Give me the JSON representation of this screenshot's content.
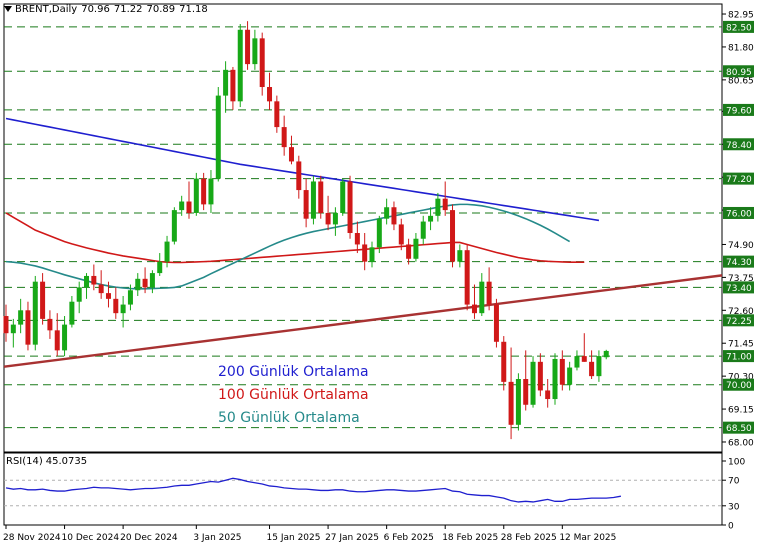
{
  "header": {
    "symbol": "BRENT,Daily",
    "open": "70.96",
    "high": "71.22",
    "low": "70.89",
    "close": "71.18"
  },
  "legend": [
    {
      "label": "200 Günlük Ortalama",
      "color": "#1f1fcf"
    },
    {
      "label": "100 Günlük Ortalama",
      "color": "#d01818"
    },
    {
      "label": "50 Günlük Ortalama",
      "color": "#258a8a"
    }
  ],
  "rsi": {
    "label": "RSI(14)",
    "value": "45.0735",
    "ticks": [
      "100",
      "70",
      "30",
      "0"
    ]
  },
  "chart_data": {
    "type": "candlestick",
    "colors": {
      "up": "#17a817",
      "down": "#d01818",
      "ma200": "#1f1fcf",
      "ma100": "#d01818",
      "ma50": "#258a8a",
      "trendline": "#a83232",
      "rsi": "#1f1fcf"
    },
    "price_axis": {
      "ylim": [
        67.65,
        83.3
      ],
      "ticks": [
        "82.95",
        "81.80",
        "80.65",
        "79.55",
        "78.40",
        "77.25",
        "76.10",
        "74.90",
        "73.75",
        "72.60",
        "71.45",
        "70.30",
        "69.15",
        "68.00"
      ]
    },
    "level_lines": [
      82.5,
      80.95,
      79.6,
      78.4,
      77.2,
      76.0,
      74.3,
      73.4,
      72.25,
      71.0,
      70.0,
      68.5
    ],
    "level_labels": [
      "82.50",
      "80.95",
      "79.60",
      "78.40",
      "77.20",
      "76.00",
      "74.30",
      "73.40",
      "72.25",
      "71.00",
      "70.00",
      "68.50"
    ],
    "x_labels": [
      "28 Nov 2024",
      "10 Dec 2024",
      "20 Dec 2024",
      "3 Jan 2025",
      "15 Jan 2025",
      "27 Jan 2025",
      "6 Feb 2025",
      "18 Feb 2025",
      "28 Feb 2025",
      "12 Mar 2025"
    ],
    "x_label_index": [
      0,
      8,
      16,
      26,
      36,
      44,
      52,
      60,
      68,
      76
    ],
    "candles": [
      [
        72.4,
        72.8,
        71.5,
        71.8
      ],
      [
        71.8,
        72.3,
        71.3,
        72.1
      ],
      [
        72.1,
        73.0,
        71.8,
        72.6
      ],
      [
        72.6,
        72.9,
        71.2,
        71.4
      ],
      [
        71.4,
        73.8,
        71.2,
        73.6
      ],
      [
        73.6,
        73.9,
        72.1,
        72.3
      ],
      [
        72.3,
        72.6,
        71.6,
        71.9
      ],
      [
        71.9,
        72.5,
        71.0,
        71.2
      ],
      [
        71.2,
        72.4,
        71.0,
        72.1
      ],
      [
        72.1,
        73.1,
        72.0,
        72.9
      ],
      [
        72.9,
        73.6,
        72.5,
        73.4
      ],
      [
        73.4,
        73.9,
        73.0,
        73.8
      ],
      [
        73.8,
        74.2,
        73.3,
        73.5
      ],
      [
        73.5,
        74.0,
        73.0,
        73.2
      ],
      [
        73.2,
        73.6,
        72.7,
        73.0
      ],
      [
        73.0,
        73.4,
        72.3,
        72.5
      ],
      [
        72.5,
        73.1,
        72.0,
        72.8
      ],
      [
        72.8,
        73.5,
        72.6,
        73.3
      ],
      [
        73.3,
        73.9,
        73.1,
        73.7
      ],
      [
        73.7,
        74.1,
        73.2,
        73.4
      ],
      [
        73.4,
        74.0,
        73.2,
        73.9
      ],
      [
        73.9,
        74.6,
        73.8,
        74.3
      ],
      [
        74.3,
        75.2,
        74.1,
        75.0
      ],
      [
        75.0,
        76.2,
        74.9,
        76.1
      ],
      [
        76.1,
        76.6,
        75.9,
        76.4
      ],
      [
        76.4,
        77.1,
        75.8,
        76.0
      ],
      [
        76.0,
        77.4,
        75.9,
        77.2
      ],
      [
        77.2,
        77.4,
        76.1,
        76.3
      ],
      [
        76.3,
        77.5,
        76.0,
        77.2
      ],
      [
        77.2,
        80.4,
        77.1,
        80.1
      ],
      [
        80.1,
        81.3,
        79.5,
        81.0
      ],
      [
        81.0,
        81.1,
        79.6,
        79.9
      ],
      [
        79.9,
        82.6,
        79.7,
        82.4
      ],
      [
        82.4,
        82.7,
        81.0,
        81.2
      ],
      [
        81.2,
        82.4,
        81.0,
        82.1
      ],
      [
        82.1,
        82.3,
        80.1,
        80.4
      ],
      [
        80.4,
        80.9,
        79.6,
        79.9
      ],
      [
        79.9,
        80.1,
        78.8,
        79.0
      ],
      [
        79.0,
        79.4,
        78.0,
        78.3
      ],
      [
        78.3,
        78.7,
        77.7,
        77.8
      ],
      [
        77.8,
        78.0,
        76.5,
        76.8
      ],
      [
        76.8,
        77.2,
        75.5,
        75.8
      ],
      [
        75.8,
        77.3,
        75.6,
        77.1
      ],
      [
        77.1,
        77.3,
        75.8,
        76.0
      ],
      [
        76.0,
        76.6,
        75.4,
        75.6
      ],
      [
        75.6,
        76.2,
        75.2,
        76.0
      ],
      [
        76.0,
        77.2,
        75.9,
        77.1
      ],
      [
        77.1,
        77.3,
        75.1,
        75.3
      ],
      [
        75.3,
        75.7,
        74.6,
        74.9
      ],
      [
        74.9,
        75.3,
        74.0,
        74.3
      ],
      [
        74.3,
        75.0,
        74.1,
        74.8
      ],
      [
        74.8,
        75.9,
        74.6,
        75.8
      ],
      [
        75.8,
        76.5,
        75.6,
        76.2
      ],
      [
        76.2,
        76.4,
        75.4,
        75.6
      ],
      [
        75.6,
        75.8,
        74.7,
        74.9
      ],
      [
        74.9,
        75.1,
        74.2,
        74.4
      ],
      [
        74.4,
        75.3,
        74.3,
        75.1
      ],
      [
        75.1,
        75.9,
        74.9,
        75.7
      ],
      [
        75.7,
        76.2,
        75.4,
        75.9
      ],
      [
        75.9,
        76.7,
        75.7,
        76.5
      ],
      [
        76.5,
        77.1,
        75.9,
        76.1
      ],
      [
        76.1,
        76.3,
        74.1,
        74.3
      ],
      [
        74.3,
        74.9,
        74.1,
        74.7
      ],
      [
        74.7,
        74.9,
        72.6,
        72.8
      ],
      [
        72.8,
        73.5,
        72.3,
        72.5
      ],
      [
        72.5,
        73.9,
        72.4,
        73.6
      ],
      [
        73.6,
        74.1,
        72.6,
        72.8
      ],
      [
        72.8,
        73.0,
        71.3,
        71.5
      ],
      [
        71.5,
        71.7,
        69.8,
        70.1
      ],
      [
        70.1,
        71.3,
        68.1,
        68.6
      ],
      [
        68.6,
        70.4,
        68.4,
        70.2
      ],
      [
        70.2,
        71.2,
        69.1,
        69.3
      ],
      [
        69.3,
        71.0,
        69.2,
        70.8
      ],
      [
        70.8,
        71.1,
        69.6,
        69.8
      ],
      [
        69.8,
        70.2,
        69.2,
        69.5
      ],
      [
        69.5,
        71.1,
        69.3,
        70.9
      ],
      [
        70.9,
        71.2,
        69.8,
        70.0
      ],
      [
        70.0,
        70.8,
        69.8,
        70.6
      ],
      [
        70.6,
        71.2,
        70.5,
        71.0
      ],
      [
        71.0,
        71.8,
        70.8,
        70.8
      ],
      [
        70.8,
        71.2,
        70.2,
        70.3
      ],
      [
        70.3,
        71.2,
        70.1,
        71.0
      ],
      [
        70.96,
        71.22,
        70.89,
        71.18
      ]
    ],
    "trendline": {
      "from": [
        0,
        70.63
      ],
      "to_right_edge": 73.82
    },
    "ma200": [
      79.3,
      79.25,
      79.2,
      79.15,
      79.1,
      79.05,
      79.0,
      78.95,
      78.9,
      78.85,
      78.8,
      78.75,
      78.7,
      78.65,
      78.6,
      78.55,
      78.5,
      78.45,
      78.4,
      78.35,
      78.3,
      78.25,
      78.2,
      78.15,
      78.1,
      78.05,
      78.0,
      77.95,
      77.9,
      77.85,
      77.8,
      77.75,
      77.7,
      77.66,
      77.62,
      77.58,
      77.54,
      77.5,
      77.46,
      77.42,
      77.38,
      77.34,
      77.3,
      77.26,
      77.22,
      77.18,
      77.14,
      77.1,
      77.06,
      77.02,
      76.98,
      76.94,
      76.9,
      76.86,
      76.82,
      76.78,
      76.74,
      76.7,
      76.66,
      76.62,
      76.58,
      76.54,
      76.5,
      76.46,
      76.42,
      76.38,
      76.34,
      76.3,
      76.26,
      76.22,
      76.18,
      76.14,
      76.1,
      76.06,
      76.02,
      75.98,
      75.94,
      75.9,
      75.86,
      75.82,
      75.78,
      75.74
    ],
    "ma100": [
      76.0,
      75.85,
      75.7,
      75.55,
      75.4,
      75.3,
      75.2,
      75.1,
      75.0,
      74.92,
      74.85,
      74.78,
      74.72,
      74.66,
      74.6,
      74.55,
      74.5,
      74.46,
      74.42,
      74.38,
      74.34,
      74.3,
      74.28,
      74.27,
      74.27,
      74.28,
      74.29,
      74.3,
      74.31,
      74.33,
      74.35,
      74.37,
      74.39,
      74.41,
      74.43,
      74.45,
      74.47,
      74.49,
      74.51,
      74.53,
      74.55,
      74.57,
      74.59,
      74.61,
      74.63,
      74.65,
      74.67,
      74.69,
      74.71,
      74.73,
      74.75,
      74.77,
      74.79,
      74.81,
      74.83,
      74.85,
      74.87,
      74.89,
      74.91,
      74.93,
      74.95,
      74.97,
      74.97,
      74.9,
      74.83,
      74.76,
      74.69,
      74.62,
      74.56,
      74.5,
      74.44,
      74.4,
      74.36,
      74.33,
      74.31,
      74.3,
      74.29,
      74.28,
      74.28,
      74.28
    ],
    "ma50": [
      74.3,
      74.28,
      74.25,
      74.2,
      74.15,
      74.08,
      74.0,
      73.92,
      73.84,
      73.77,
      73.7,
      73.63,
      73.56,
      73.5,
      73.45,
      73.41,
      73.38,
      73.36,
      73.35,
      73.35,
      73.36,
      73.37,
      73.38,
      73.4,
      73.45,
      73.55,
      73.65,
      73.75,
      73.88,
      74.0,
      74.12,
      74.24,
      74.36,
      74.48,
      74.6,
      74.72,
      74.84,
      74.95,
      75.05,
      75.14,
      75.22,
      75.29,
      75.35,
      75.4,
      75.45,
      75.5,
      75.55,
      75.6,
      75.65,
      75.7,
      75.75,
      75.8,
      75.85,
      75.9,
      75.95,
      76.0,
      76.05,
      76.1,
      76.15,
      76.2,
      76.24,
      76.28,
      76.3,
      76.3,
      76.28,
      76.25,
      76.2,
      76.14,
      76.07,
      75.99,
      75.9,
      75.8,
      75.69,
      75.57,
      75.44,
      75.3,
      75.15,
      75.0
    ],
    "rsi_values": [
      58,
      56,
      57,
      55,
      55,
      56,
      54,
      53,
      53,
      55,
      56,
      57,
      59,
      58,
      58,
      57,
      56,
      55,
      56,
      57,
      57,
      58,
      59,
      61,
      62,
      62,
      64,
      66,
      68,
      67,
      70,
      73,
      71,
      68,
      66,
      64,
      61,
      60,
      58,
      57,
      56,
      56,
      55,
      54,
      54,
      55,
      55,
      53,
      52,
      52,
      53,
      54,
      55,
      55,
      54,
      53,
      53,
      54,
      55,
      56,
      57,
      53,
      52,
      48,
      47,
      46,
      46,
      44,
      42,
      38,
      36,
      37,
      36,
      38,
      40,
      37,
      37,
      40,
      40,
      41,
      42,
      42,
      42,
      43,
      45
    ]
  }
}
